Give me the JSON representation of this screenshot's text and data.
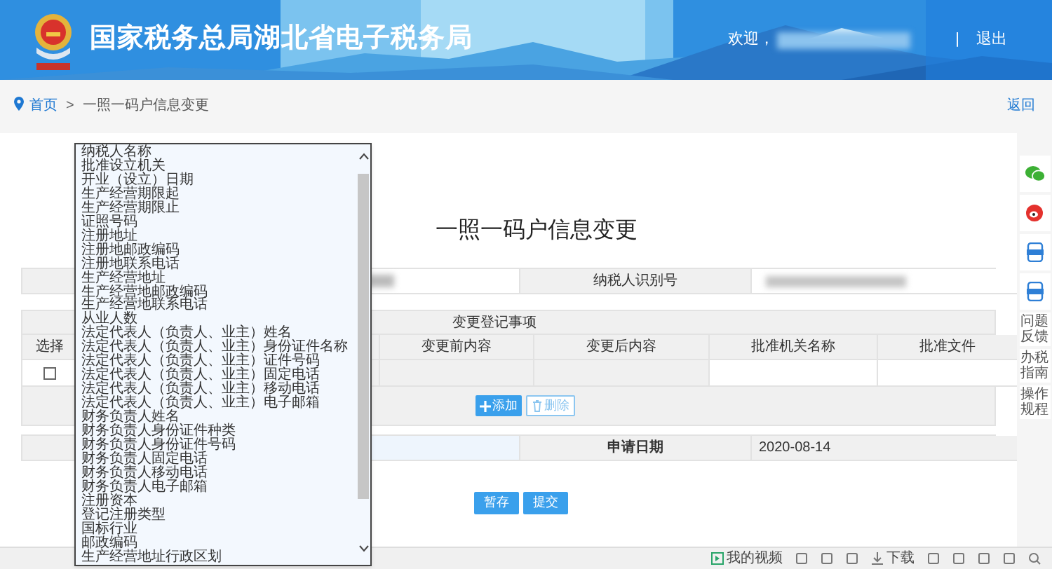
{
  "header": {
    "title": "国家税务总局湖北省电子税务局",
    "welcome": "欢迎，",
    "separator": "|",
    "logout": "退出"
  },
  "breadcrumb": {
    "items": [
      "首页",
      "一照一码户信息变更"
    ],
    "separator": ">",
    "back": "返回"
  },
  "page_title": "一照一码户信息变更",
  "taxpayer_row": {
    "id_label": "纳税人识别号"
  },
  "change_table": {
    "section": "变更登记事项",
    "columns": [
      "选择",
      "变更前内容",
      "变更后内容",
      "批准机关名称",
      "批准文件"
    ],
    "rows": [
      {
        "checked": false
      }
    ]
  },
  "row_buttons": [
    {
      "kind": "add",
      "label": "添加"
    },
    {
      "kind": "delete",
      "label": "删除"
    }
  ],
  "apply_date": {
    "label": "申请日期",
    "value": "2020-08-14"
  },
  "actions": [
    "暂存",
    "提交"
  ],
  "dropdown": {
    "items": [
      "纳税人名称",
      "批准设立机关",
      "开业（设立）日期",
      "生产经营期限起",
      "生产经营期限止",
      "证照号码",
      "注册地址",
      "注册地邮政编码",
      "注册地联系电话",
      "生产经营地址",
      "生产经营地邮政编码",
      "生产经营地联系电话",
      "从业人数",
      "法定代表人（负责人、业主）姓名",
      "法定代表人（负责人、业主）身份证件名称",
      "法定代表人（负责人、业主）证件号码",
      "法定代表人（负责人、业主）固定电话",
      "法定代表人（负责人、业主）移动电话",
      "法定代表人（负责人、业主）电子邮箱",
      "财务负责人姓名",
      "财务负责人身份证件种类",
      "财务负责人身份证件号码",
      "财务负责人固定电话",
      "财务负责人移动电话",
      "财务负责人电子邮箱",
      "注册资本",
      "登记注册类型",
      "国标行业",
      "邮政编码",
      "生产经营地址行政区划"
    ]
  },
  "side_tools": [
    {
      "kind": "wechat"
    },
    {
      "kind": "weibo"
    },
    {
      "kind": "app"
    },
    {
      "kind": "app"
    },
    {
      "kind": "text",
      "label": "问题反馈"
    },
    {
      "kind": "text",
      "label": "办税指南"
    },
    {
      "kind": "text",
      "label": "操作规程"
    }
  ],
  "status_bar": [
    {
      "kind": "video",
      "label": "我的视频"
    },
    {
      "kind": "icon"
    },
    {
      "kind": "icon"
    },
    {
      "kind": "icon"
    },
    {
      "kind": "download",
      "label": "下载"
    },
    {
      "kind": "icon"
    },
    {
      "kind": "icon"
    },
    {
      "kind": "icon"
    },
    {
      "kind": "icon"
    },
    {
      "kind": "search"
    }
  ]
}
